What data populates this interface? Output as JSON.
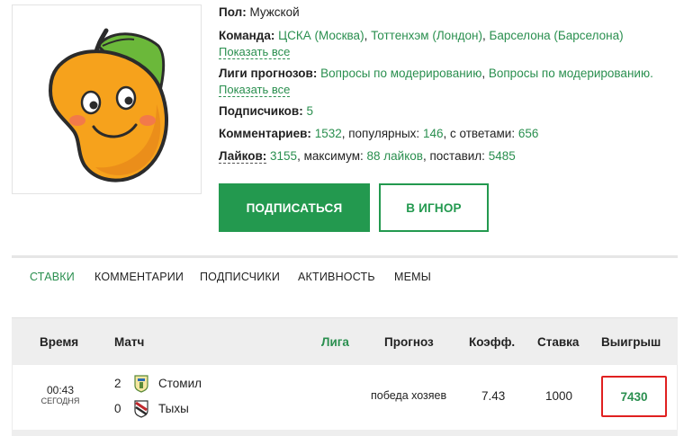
{
  "profile": {
    "gender_label": "Пол:",
    "gender_value": "Мужской",
    "team_label": "Команда:",
    "teams": [
      "ЦСКА (Москва)",
      "Тоттенхэм (Лондон)",
      "Барселона (Барселона)"
    ],
    "show_all": "Показать все",
    "leagues_label": "Лиги прогнозов:",
    "leagues": [
      "Вопросы по модерированию",
      "Вопросы по модерированию."
    ],
    "subscribers_label": "Подписчиков:",
    "subscribers_value": "5",
    "comments_label": "Комментариев:",
    "comments_value": "1532",
    "popular_label": ", популярных:",
    "popular_value": "146",
    "with_answers_label": ", с ответами:",
    "with_answers_value": "656",
    "likes_label": "Лайков:",
    "likes_value": "3155",
    "max_label": ", максимум:",
    "max_value": "88 лайков",
    "given_label": ", поставил:",
    "given_value": "5485"
  },
  "actions": {
    "subscribe": "ПОДПИСАТЬСЯ",
    "ignore": "В ИГНОР"
  },
  "tabs": [
    "СТАВКИ",
    "КОММЕНТАРИИ",
    "ПОДПИСЧИКИ",
    "АКТИВНОСТЬ",
    "МЕМЫ"
  ],
  "table": {
    "headers": {
      "time": "Время",
      "match": "Матч",
      "league": "Лига",
      "forecast": "Прогноз",
      "coef": "Коэфф.",
      "stake": "Ставка",
      "win": "Выигрыш"
    },
    "rows": [
      {
        "time": "00:43",
        "date": "СЕГОДНЯ",
        "home_score": "2",
        "home_team": "Стомил",
        "away_score": "0",
        "away_team": "Тыхы",
        "forecast": "победа хозяев",
        "coef": "7.43",
        "stake": "1000",
        "win": "7430"
      }
    ]
  },
  "colors": {
    "accent": "#23994f",
    "link": "#2a8f4f",
    "highlight_border": "#e02020",
    "header_bg": "#eeeeee"
  },
  "icons": {
    "avatar": "mango-character-avatar",
    "home_team_icon": "stomil-crest-icon",
    "away_team_icon": "tychy-crest-icon"
  }
}
